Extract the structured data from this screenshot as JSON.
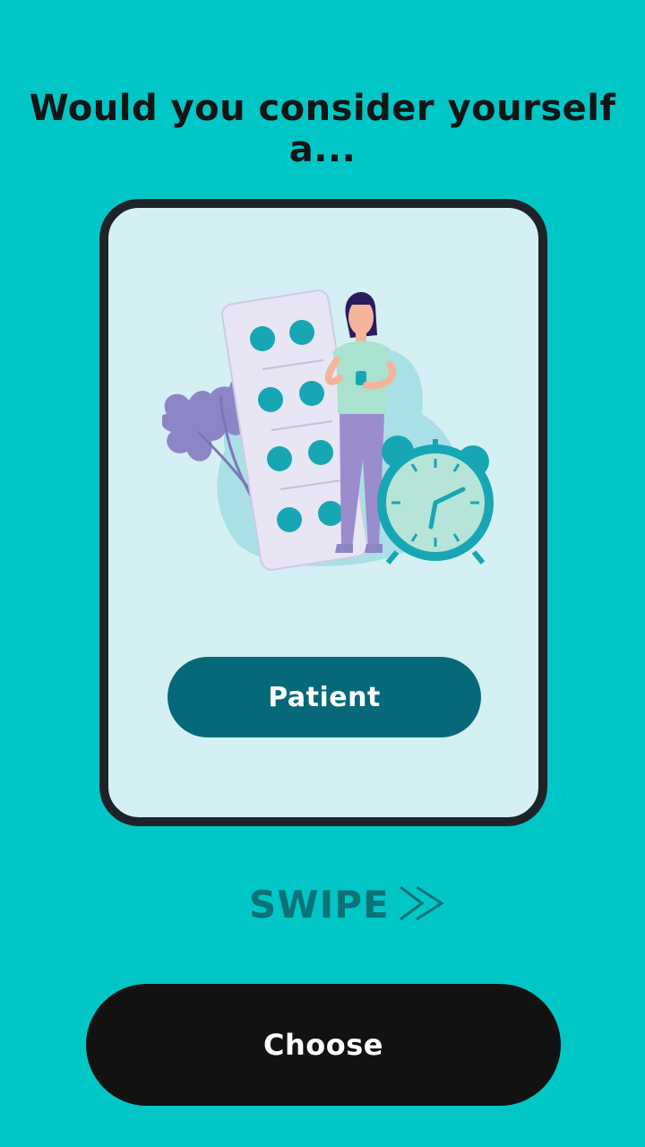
{
  "question": "Would you consider yourself a...",
  "card": {
    "illustration": "patient-with-medication-and-clock",
    "role_label": "Patient"
  },
  "swipe": {
    "label": "SWIPE",
    "icon": "double-chevron-right-icon"
  },
  "choose_label": "Choose",
  "colors": {
    "background": "#00c6c6",
    "card": "#d4f0f4",
    "card_border": "#1e2328",
    "role_button": "#05697a",
    "swipe_text": "#0a7377",
    "choose_button": "#121212"
  }
}
